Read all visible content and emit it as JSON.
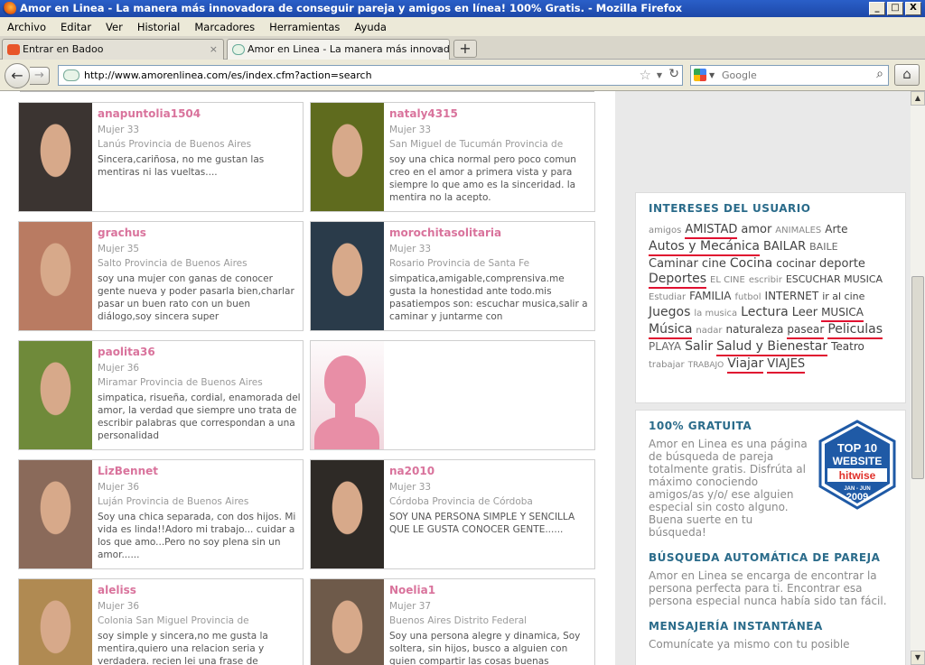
{
  "window": {
    "title": "Amor en Linea - La manera más innovadora de conseguir pareja y amigos en línea! 100% Gratis. - Mozilla Firefox",
    "min": "_",
    "max": "□",
    "close": "X"
  },
  "menu": [
    "Archivo",
    "Editar",
    "Ver",
    "Historial",
    "Marcadores",
    "Herramientas",
    "Ayuda"
  ],
  "tabs": [
    {
      "label": "Entrar en Badoo",
      "close": "×"
    },
    {
      "label": "Amor en Linea - La manera más innovado...",
      "close": "×"
    }
  ],
  "newtab": "+",
  "nav": {
    "back": "←",
    "forward": "→",
    "url": "http://www.amorenlinea.com/es/index.cfm?action=search",
    "star": "☆",
    "reload": "↻",
    "home": "⌂"
  },
  "search": {
    "placeholder": "Google",
    "icon": "magnifier-icon"
  },
  "profiles": [
    {
      "username": "anapuntolia1504",
      "age": "Mujer 33",
      "location": "Lanús Provincia de Buenos Aires",
      "description": "Sincera,cariñosa, no me gustan las mentiras ni las vueltas....",
      "photo_bg": "#3b3431"
    },
    {
      "username": "nataly4315",
      "age": "Mujer 33",
      "location": "San Miguel de Tucumán Provincia de",
      "description": "soy una chica normal pero poco comun creo en el amor a primera vista y para siempre lo que amo es la sinceridad. la mentira no la acepto.",
      "photo_bg": "#5f6b1e"
    },
    {
      "username": "grachus",
      "age": "Mujer 35",
      "location": "Salto Provincia de Buenos Aires",
      "description": "soy una mujer con ganas de conocer gente nueva y poder pasarla bien,charlar pasar un buen rato con un buen diálogo,soy sincera super",
      "photo_bg": "#b97b62"
    },
    {
      "username": "morochitasolitaria",
      "age": "Mujer 33",
      "location": "Rosario Provincia de Santa Fe",
      "description": "simpatica,amigable,comprensiva.me gusta la honestidad ante todo.mis pasatiempos son: escuchar musica,salir a caminar y juntarme con",
      "photo_bg": "#2a3b4a"
    },
    {
      "username": "paolita36",
      "age": "Mujer 36",
      "location": "Miramar Provincia de Buenos Aires",
      "description": "simpatica, risueña, cordial, enamorada del amor, la verdad que siempre uno trata de escribir palabras que correspondan a una personalidad",
      "photo_bg": "#6f8a3a"
    },
    {
      "username": "",
      "age": "",
      "location": "",
      "description": "",
      "photo_bg": "silhouette"
    },
    {
      "username": "LizBennet",
      "age": "Mujer 36",
      "location": "Luján Provincia de Buenos Aires",
      "description": "Soy una chica separada, con dos hijos. Mi vida es linda!!Adoro mi trabajo... cuidar a los que amo...Pero no soy plena sin un amor......",
      "photo_bg": "#8a6a5a"
    },
    {
      "username": "na2010",
      "age": "Mujer 33",
      "location": "Córdoba Provincia de Córdoba",
      "description": "SOY UNA PERSONA SIMPLE Y SENCILLA QUE LE GUSTA CONOCER GENTE......",
      "photo_bg": "#2e2a26"
    },
    {
      "username": "aleliss",
      "age": "Mujer 36",
      "location": "Colonia San Miguel Provincia de",
      "description": "soy simple y sincera,no me gusta la mentira,quiero una relacion seria y verdadera. recien lei una frase de",
      "photo_bg": "#b08a52"
    },
    {
      "username": "Noelia1",
      "age": "Mujer 37",
      "location": "Buenos Aires Distrito Federal",
      "description": "Soy una persona alegre y dinamica, Soy soltera, sin hijos, busco a alguien con quien compartir las cosas buenas",
      "photo_bg": "#6e5a4a"
    }
  ],
  "interests": {
    "title": "INTERESES DEL USUARIO",
    "tags": [
      {
        "t": "amigos",
        "s": 10,
        "u": false,
        "c": "#888"
      },
      {
        "t": "AMISTAD",
        "s": 13,
        "u": true,
        "c": "#444"
      },
      {
        "t": "amor",
        "s": 13,
        "u": false,
        "c": "#444"
      },
      {
        "t": "ANIMALES",
        "s": 10,
        "u": false,
        "c": "#888"
      },
      {
        "t": "Arte",
        "s": 12,
        "u": false,
        "c": "#444"
      },
      {
        "t": "Autos y Mecánica",
        "s": 14,
        "u": true,
        "c": "#444"
      },
      {
        "t": "BAILAR",
        "s": 13,
        "u": false,
        "c": "#444"
      },
      {
        "t": "BAILE",
        "s": 11,
        "u": false,
        "c": "#666"
      },
      {
        "t": "Caminar",
        "s": 13,
        "u": false,
        "c": "#444"
      },
      {
        "t": "cine",
        "s": 13,
        "u": false,
        "c": "#444"
      },
      {
        "t": "Cocina",
        "s": 14,
        "u": false,
        "c": "#444"
      },
      {
        "t": "cocinar",
        "s": 12,
        "u": false,
        "c": "#444"
      },
      {
        "t": "deporte",
        "s": 13,
        "u": false,
        "c": "#444"
      },
      {
        "t": "Deportes",
        "s": 14,
        "u": true,
        "c": "#444"
      },
      {
        "t": "EL CINE",
        "s": 10,
        "u": false,
        "c": "#888"
      },
      {
        "t": "escribir",
        "s": 10,
        "u": false,
        "c": "#888"
      },
      {
        "t": "ESCUCHAR MUSICA",
        "s": 11,
        "u": false,
        "c": "#444"
      },
      {
        "t": "Estudiar",
        "s": 10,
        "u": false,
        "c": "#888"
      },
      {
        "t": "FAMILIA",
        "s": 12,
        "u": false,
        "c": "#444"
      },
      {
        "t": "futbol",
        "s": 10,
        "u": false,
        "c": "#888"
      },
      {
        "t": "INTERNET",
        "s": 12,
        "u": false,
        "c": "#444"
      },
      {
        "t": "ir al cine",
        "s": 11,
        "u": false,
        "c": "#444"
      },
      {
        "t": "Juegos",
        "s": 14,
        "u": false,
        "c": "#444"
      },
      {
        "t": "la musica",
        "s": 10,
        "u": false,
        "c": "#888"
      },
      {
        "t": "Lectura",
        "s": 14,
        "u": false,
        "c": "#444"
      },
      {
        "t": "Leer",
        "s": 13,
        "u": false,
        "c": "#444"
      },
      {
        "t": "MUSICA",
        "s": 12,
        "u": true,
        "c": "#444"
      },
      {
        "t": "Música",
        "s": 14,
        "u": true,
        "c": "#444"
      },
      {
        "t": "nadar",
        "s": 10,
        "u": false,
        "c": "#888"
      },
      {
        "t": "naturaleza",
        "s": 12,
        "u": false,
        "c": "#444"
      },
      {
        "t": "pasear",
        "s": 12,
        "u": true,
        "c": "#444"
      },
      {
        "t": "Peliculas",
        "s": 14,
        "u": true,
        "c": "#444"
      },
      {
        "t": "PLAYA",
        "s": 12,
        "u": false,
        "c": "#666"
      },
      {
        "t": "Salir",
        "s": 14,
        "u": false,
        "c": "#444"
      },
      {
        "t": "Salud y Bienestar",
        "s": 14,
        "u": true,
        "c": "#444"
      },
      {
        "t": "Teatro",
        "s": 12,
        "u": false,
        "c": "#444"
      },
      {
        "t": "trabajar",
        "s": 10,
        "u": false,
        "c": "#888"
      },
      {
        "t": "TRABAJO",
        "s": 9,
        "u": false,
        "c": "#888"
      },
      {
        "t": "Viajar",
        "s": 14,
        "u": true,
        "c": "#444"
      },
      {
        "t": "VIAJES",
        "s": 13,
        "u": true,
        "c": "#444"
      }
    ]
  },
  "info": {
    "gratuita_title": "100% GRATUITA",
    "gratuita_text": "Amor en Linea es una página de búsqueda de pareja totalmente gratis. Disfrúta al máximo conociendo amigos/as y/o/ ese alguien especial sin costo alguno. Buena suerte en tu búsqueda!",
    "badge": {
      "line1": "TOP 10",
      "line2": "WEBSITE",
      "brand": "hitwise",
      "date": "JAN - JUN",
      "year": "2009"
    },
    "busqueda_title": "BÚSQUEDA AUTOMÁTICA DE PAREJA",
    "busqueda_text": "Amor en Linea se encarga de encontrar la persona perfecta para ti. Encontrar esa persona especial nunca había sido tan fácil.",
    "mensajeria_title": "MENSAJERÍA INSTANTÁNEA",
    "mensajeria_text": "Comunícate ya mismo con tu posible"
  },
  "colors": {
    "username": "#d9739c",
    "heading": "#2a6b8a",
    "underline": "#e01030"
  }
}
